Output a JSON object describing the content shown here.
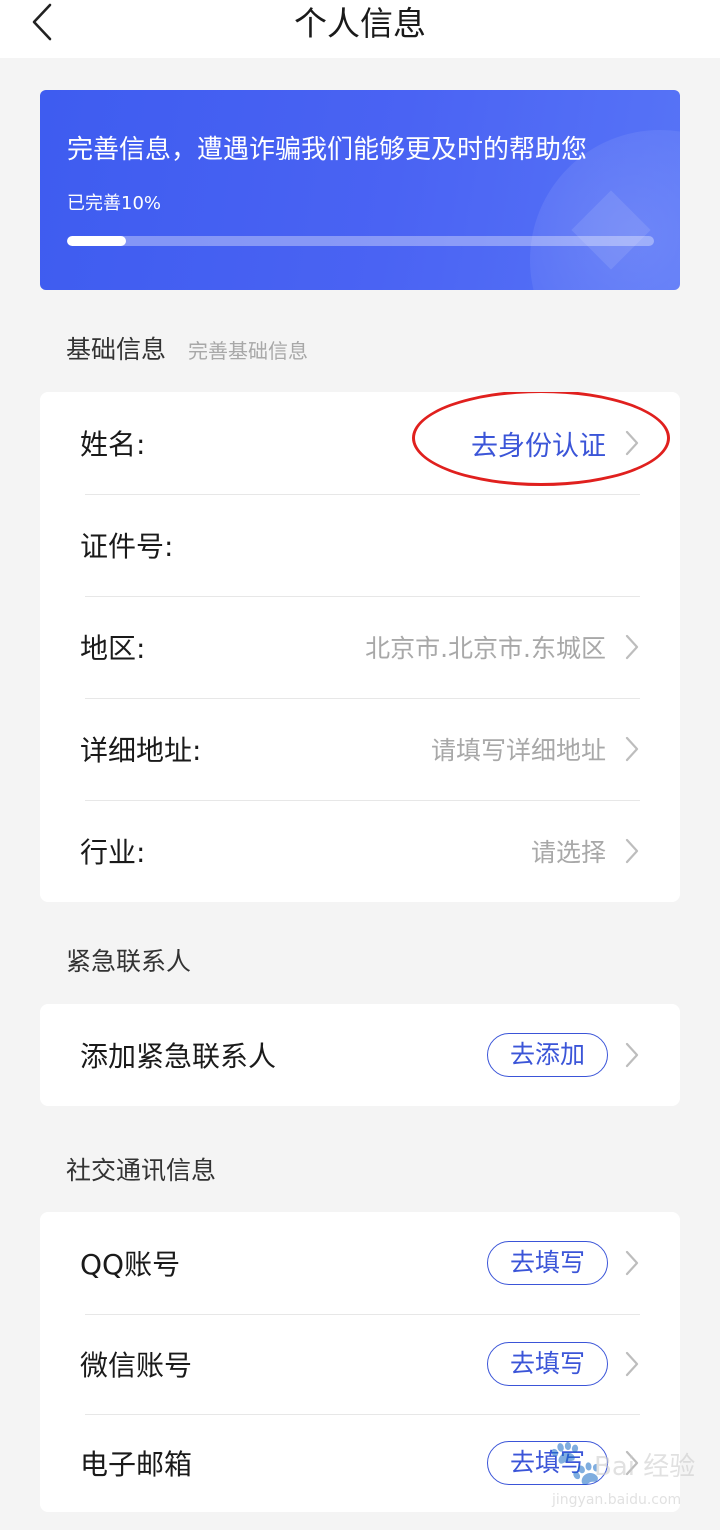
{
  "header": {
    "title": "个人信息",
    "back_icon": "chevron-left-icon"
  },
  "banner": {
    "title": "完善信息，遭遇诈骗我们能够更及时的帮助您",
    "progress_text": "已完善10%",
    "progress_fraction": 0.1
  },
  "basic": {
    "title": "基础信息",
    "subtitle": "完善基础信息",
    "rows": [
      {
        "label": "姓名:",
        "value": "去身份认证"
      },
      {
        "label": "证件号:",
        "value": ""
      },
      {
        "label": "地区:",
        "value": "北京市.北京市.东城区"
      },
      {
        "label": "详细地址:",
        "value": "请填写详细地址"
      },
      {
        "label": "行业:",
        "value": "请选择"
      }
    ]
  },
  "emergency": {
    "title": "紧急联系人",
    "rows": [
      {
        "label": "添加紧急联系人",
        "button": "去添加"
      }
    ]
  },
  "social": {
    "title": "社交通讯信息",
    "rows": [
      {
        "label": "QQ账号",
        "button": "去填写"
      },
      {
        "label": "微信账号",
        "button": "去填写"
      },
      {
        "label": "电子邮箱",
        "button": "去填写"
      }
    ]
  },
  "colors": {
    "accent": "#3b55d8",
    "banner": "#4a63f3",
    "annotation": "#e0201e"
  },
  "watermark": {
    "brand": "Bai 经验",
    "url": "jingyan.baidu.com"
  }
}
